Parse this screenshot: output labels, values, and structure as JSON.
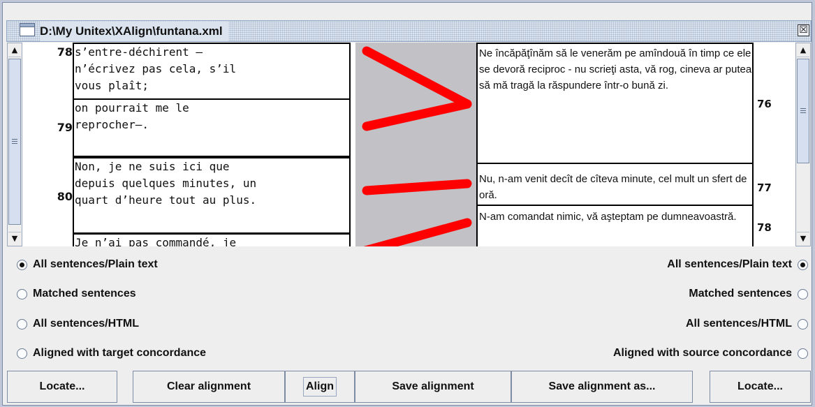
{
  "window": {
    "title": "D:\\My Unitex\\XAlign\\funtana.xml",
    "close_glyph": "☒"
  },
  "source": {
    "rows": [
      {
        "num": "78",
        "text": "s’entre-déchirent –\nn’écrivez pas cela, s’il\nvous plaît;"
      },
      {
        "num": "79",
        "text": "on pourrait me le\nreprocher–."
      },
      {
        "num": "80",
        "text": "Non, je ne suis ici que\ndepuis quelques minutes, un\nquart d’heure tout au plus."
      },
      {
        "num": "",
        "text": "Je n’ai pas commandé, je"
      }
    ]
  },
  "target": {
    "rows": [
      {
        "num": "76",
        "text": "Ne încăpăţînăm să le venerăm pe amîndouă în timp ce ele se devoră reciproc - nu scrieţi asta, vă rog, cineva ar putea să mă tragă la răspundere într-o bună zi."
      },
      {
        "num": "77",
        "text": "Nu, n-am venit decît de cîteva minute, cel mult un sfert de oră."
      },
      {
        "num": "78",
        "text": "N-am comandat nimic, vă aşteptam pe dumneavoastră."
      }
    ]
  },
  "alignment": {
    "link_color": "#ff0000",
    "panel_color": "#c2c2c6"
  },
  "options": {
    "left": [
      {
        "label": "All sentences/Plain text",
        "selected": true
      },
      {
        "label": "Matched sentences",
        "selected": false
      },
      {
        "label": "All sentences/HTML",
        "selected": false
      },
      {
        "label": "Aligned with target concordance",
        "selected": false
      }
    ],
    "right": [
      {
        "label": "All sentences/Plain text",
        "selected": true
      },
      {
        "label": "Matched sentences",
        "selected": false
      },
      {
        "label": "All sentences/HTML",
        "selected": false
      },
      {
        "label": "Aligned with source concordance",
        "selected": false
      }
    ]
  },
  "buttons": {
    "locate_left": "Locate...",
    "clear_alignment": "Clear alignment",
    "align": "Align",
    "save_alignment": "Save alignment",
    "save_alignment_as": "Save alignment as...",
    "locate_right": "Locate..."
  },
  "scroll_icons": {
    "up": "▲",
    "down": "▼"
  }
}
